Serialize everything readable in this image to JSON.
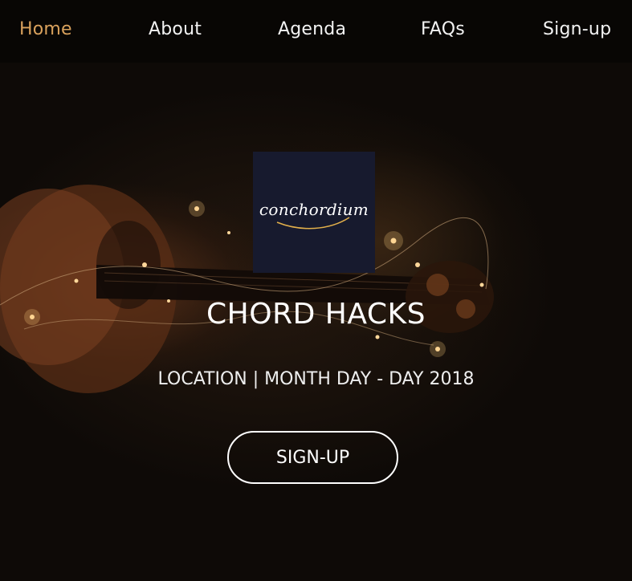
{
  "nav": {
    "items": [
      {
        "label": "Home",
        "active": true
      },
      {
        "label": "About",
        "active": false
      },
      {
        "label": "Agenda",
        "active": false
      },
      {
        "label": "FAQs",
        "active": false
      },
      {
        "label": "Sign-up",
        "active": false
      }
    ],
    "active_color": "#d9a15c",
    "text_color": "#f2f2f2"
  },
  "hero": {
    "logo_text": "conchordium",
    "logo_bg": "#171a2e",
    "logo_accent": "#e3b04b",
    "title": "CHORD HACKS",
    "subtitle": "LOCATION | MONTH DAY - DAY 2018",
    "cta_label": "SIGN-UP",
    "background_image": "violin-with-string-lights"
  }
}
